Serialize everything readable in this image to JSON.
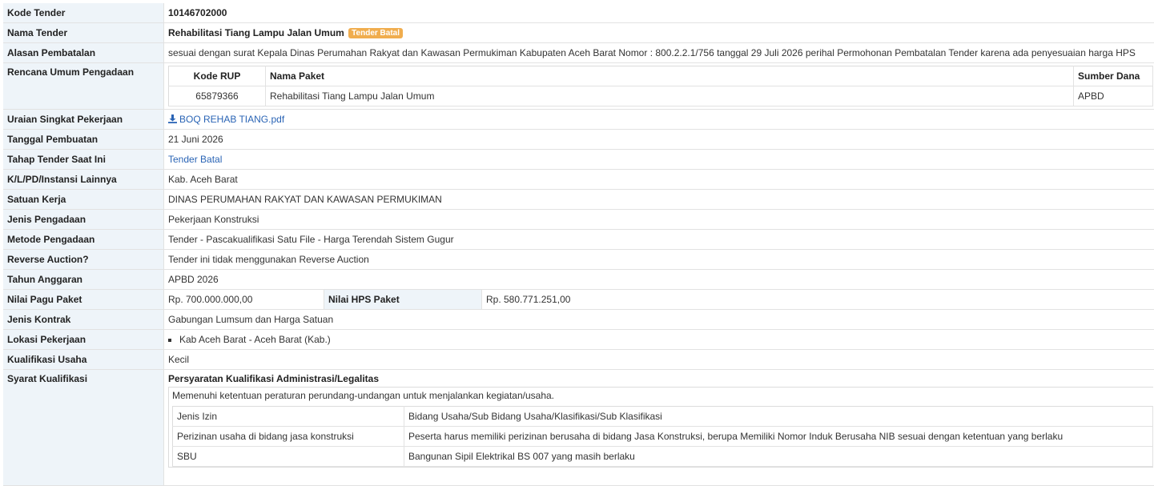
{
  "labels": {
    "kode_tender": "Kode Tender",
    "nama_tender": "Nama Tender",
    "alasan_pembatalan": "Alasan Pembatalan",
    "rencana_umum": "Rencana Umum Pengadaan",
    "uraian": "Uraian Singkat Pekerjaan",
    "tanggal_pembuatan": "Tanggal Pembuatan",
    "tahap_tender": "Tahap Tender Saat Ini",
    "klpd": "K/L/PD/Instansi Lainnya",
    "satuan_kerja": "Satuan Kerja",
    "jenis_pengadaan": "Jenis Pengadaan",
    "metode_pengadaan": "Metode Pengadaan",
    "reverse_auction": "Reverse Auction?",
    "tahun_anggaran": "Tahun Anggaran",
    "nilai_pagu": "Nilai Pagu Paket",
    "nilai_hps": "Nilai HPS Paket",
    "jenis_kontrak": "Jenis Kontrak",
    "lokasi": "Lokasi Pekerjaan",
    "kualifikasi": "Kualifikasi Usaha",
    "syarat": "Syarat Kualifikasi"
  },
  "values": {
    "kode_tender": "10146702000",
    "nama_tender": "Rehabilitasi Tiang Lampu Jalan Umum",
    "status_badge": "Tender Batal",
    "alasan_pembatalan": "sesuai dengan surat Kepala Dinas Perumahan Rakyat dan Kawasan Permukiman Kabupaten Aceh Barat Nomor : 800.2.2.1/756 tanggal 29 Juli 2026 perihal Permohonan Pembatalan Tender karena ada penyesuaian harga HPS",
    "uraian_file": "BOQ REHAB TIANG.pdf",
    "tanggal_pembuatan": "21 Juni 2026",
    "tahap_tender": "Tender Batal",
    "klpd": "Kab. Aceh Barat",
    "satuan_kerja": "DINAS PERUMAHAN RAKYAT DAN KAWASAN PERMUKIMAN",
    "jenis_pengadaan": "Pekerjaan Konstruksi",
    "metode_pengadaan": "Tender - Pascakualifikasi Satu File - Harga Terendah Sistem Gugur",
    "reverse_auction": "Tender ini tidak menggunakan Reverse Auction",
    "tahun_anggaran": "APBD 2026",
    "nilai_pagu": "Rp. 700.000.000,00",
    "nilai_hps": "Rp. 580.771.251,00",
    "jenis_kontrak": "Gabungan Lumsum dan Harga Satuan",
    "lokasi": [
      "Kab Aceh Barat - Aceh Barat (Kab.)"
    ],
    "kualifikasi": "Kecil"
  },
  "rup": {
    "headers": [
      "Kode RUP",
      "Nama Paket",
      "Sumber Dana"
    ],
    "rows": [
      [
        "65879366",
        "Rehabilitasi Tiang Lampu Jalan Umum",
        "APBD"
      ]
    ]
  },
  "syarat": {
    "title": "Persyaratan Kualifikasi Administrasi/Legalitas",
    "intro": "Memenuhi ketentuan peraturan perundang-undangan untuk menjalankan kegiatan/usaha.",
    "rows": [
      [
        "Jenis Izin",
        "Bidang Usaha/Sub Bidang Usaha/Klasifikasi/Sub Klasifikasi"
      ],
      [
        "Perizinan usaha di bidang jasa konstruksi",
        "Peserta harus memiliki perizinan berusaha di bidang Jasa Konstruksi, berupa Memiliki Nomor Induk Berusaha NIB sesuai dengan ketentuan yang berlaku"
      ],
      [
        "SBU",
        "Bangunan Sipil Elektrikal BS 007 yang masih berlaku"
      ]
    ]
  },
  "colors": {
    "label_bg": "#eef4f9",
    "badge": "#f0ad4e",
    "link": "#2a64b5"
  },
  "icons": {
    "download": "download-icon"
  }
}
